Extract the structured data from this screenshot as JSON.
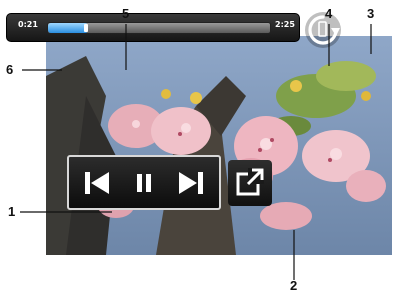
{
  "player": {
    "time_elapsed": "0:21",
    "time_total": "2:25",
    "progress_fraction": 0.18
  },
  "callouts": {
    "c1": "1",
    "c2": "2",
    "c3": "3",
    "c4": "4",
    "c5": "5",
    "c6": "6"
  },
  "icons": {
    "rotate": "rotate-icon",
    "previous": "skip-previous-icon",
    "pause": "pause-icon",
    "next": "skip-next-icon",
    "fullscreen": "fullscreen-icon"
  },
  "colors": {
    "progress_fill": "#2a8ee0",
    "panel_border": "#d8d8d8"
  }
}
